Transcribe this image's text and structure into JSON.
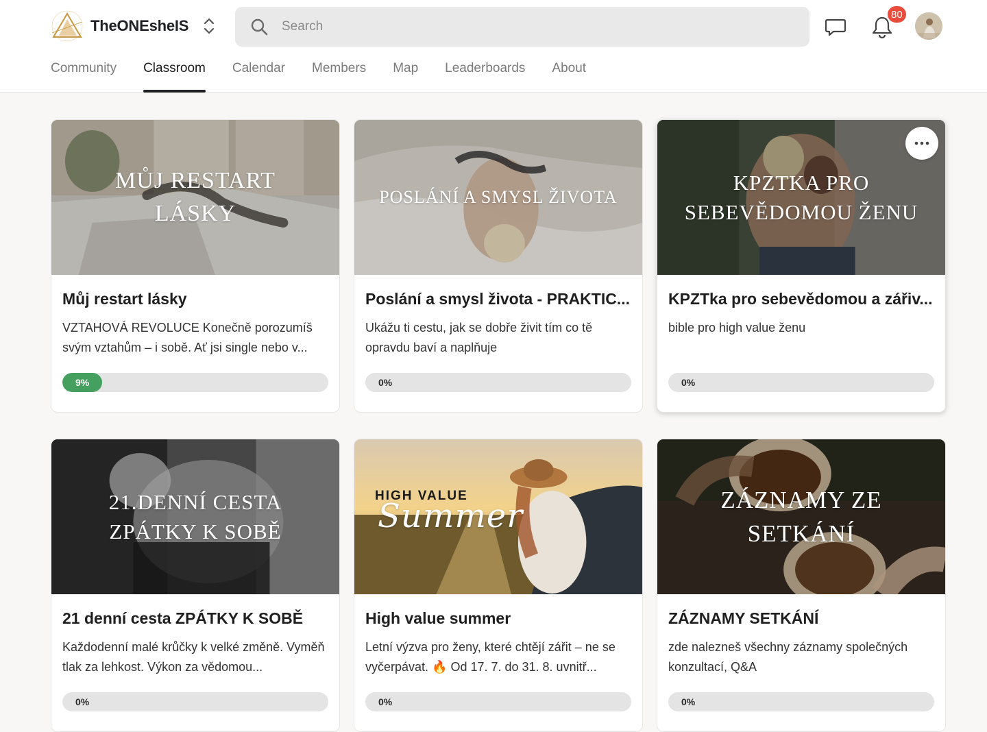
{
  "header": {
    "brand_name": "TheONEsheIS",
    "search_placeholder": "Search",
    "notifications_count": "80"
  },
  "nav": {
    "tabs": [
      "Community",
      "Classroom",
      "Calendar",
      "Members",
      "Map",
      "Leaderboards",
      "About"
    ],
    "active": "Classroom"
  },
  "courses": [
    {
      "cover_text": "MŮJ RESTART LÁSKY",
      "title": "Můj restart lásky",
      "description": "VZTAHOVÁ REVOLUCE Konečně porozumíš svým vztahům – i sobě. Ať jsi single nebo v...",
      "progress": 9,
      "progress_label": "9%"
    },
    {
      "cover_text": "POSLÁNÍ A SMYSL ŽIVOTA",
      "title": "Poslání a smysl života - PRAKTIC...",
      "description": "Ukážu ti cestu, jak se dobře živit tím co tě opravdu baví a naplňuje",
      "progress": 0,
      "progress_label": "0%"
    },
    {
      "cover_text": "KPZTKA PRO SEBEVĚDOMOU ŽENU",
      "title": "KPZTka pro sebevědomou a zářiv...",
      "description": "bible pro high value ženu",
      "progress": 0,
      "progress_label": "0%"
    },
    {
      "cover_text": "21.DENNÍ CESTA ZPÁTKY K SOBĚ",
      "title": "21 denní cesta ZPÁTKY K SOBĚ",
      "description": "Každodenní malé krůčky k velké změně. Vyměň tlak za lehkost. Výkon za vědomou...",
      "progress": 0,
      "progress_label": "0%"
    },
    {
      "cover_text_top": "HIGH VALUE",
      "cover_text_script": "Summer",
      "title": "High value summer",
      "description": "Letní výzva pro ženy, které chtějí zářit – ne se vyčerpávat. 🔥 Od 17. 7. do 31. 8. uvnitř...",
      "progress": 0,
      "progress_label": "0%"
    },
    {
      "cover_text": "ZÁZNAMY ZE SETKÁNÍ",
      "title": "ZÁZNAMY SETKÁNÍ",
      "description": "zde nalezneš všechny záznamy společných konzultací, Q&A",
      "progress": 0,
      "progress_label": "0%"
    }
  ],
  "icons": {
    "logo": "triangle-logo-icon",
    "switcher": "chevron-up-down-icon",
    "search": "search-icon",
    "chat": "chat-bubble-icon",
    "notifications": "bell-icon",
    "card_menu": "more-horizontal-icon"
  },
  "colors": {
    "accent_progress": "#45a060",
    "badge": "#e94c3b",
    "logo_gold": "#c9973f"
  }
}
